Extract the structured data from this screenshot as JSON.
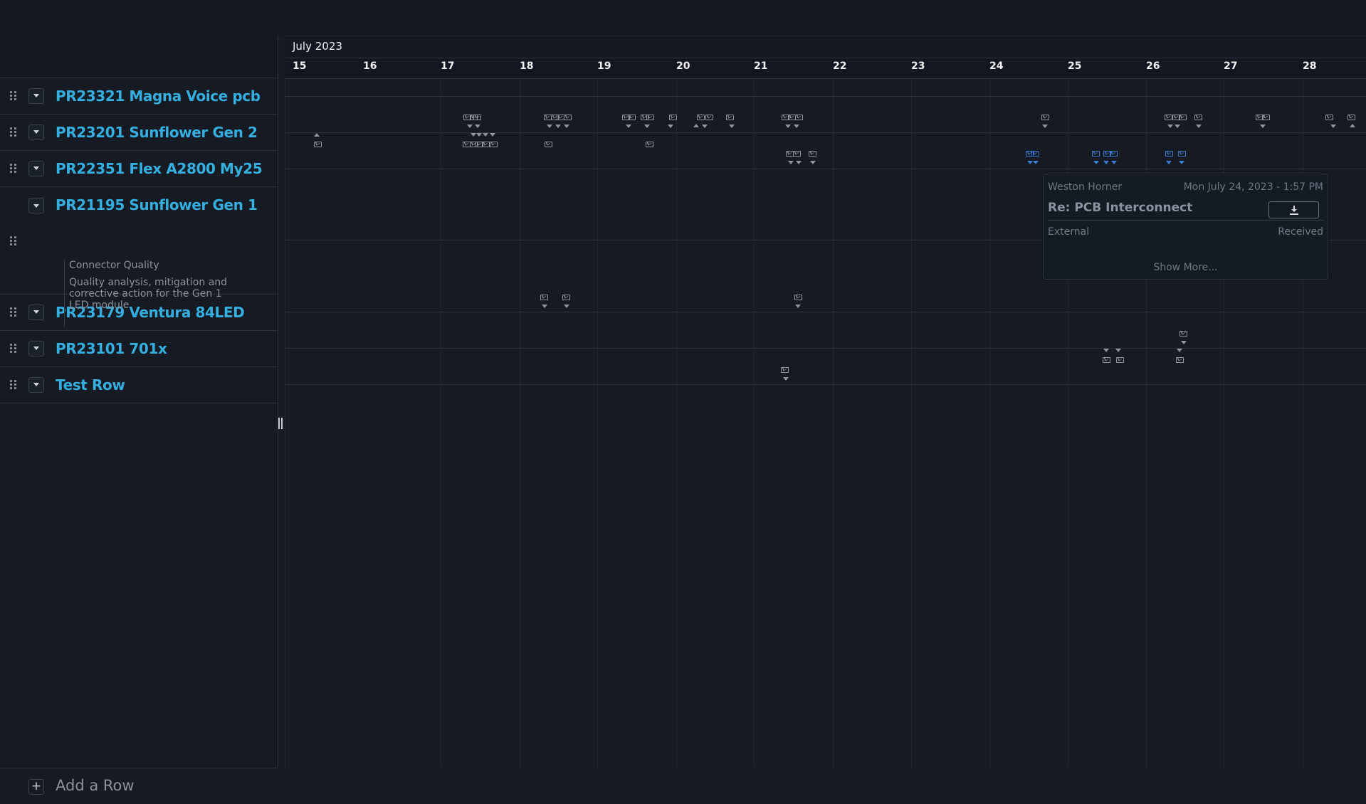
{
  "timeline": {
    "month": "July 2023",
    "days": [
      "15",
      "16",
      "17",
      "18",
      "19",
      "20",
      "21",
      "22",
      "23",
      "24",
      "25",
      "26",
      "27",
      "28"
    ]
  },
  "rows": [
    {
      "title": "PR23321 Magna Voice pcb"
    },
    {
      "title": "PR23201 Sunflower Gen 2"
    },
    {
      "title": "PR22351 Flex A2800 My25"
    },
    {
      "title": "PR21195 Sunflower Gen 1",
      "expanded": true,
      "detail_label": "Connector Quality",
      "detail_desc": "Quality analysis, mitigation and corrective action for the Gen 1 LED module"
    },
    {
      "title": "PR23179 Ventura 84LED"
    },
    {
      "title": "PR23101 701x"
    },
    {
      "title": "Test Row"
    }
  ],
  "add_row": {
    "label": "Add a Row"
  },
  "popover": {
    "sender": "Weston Horner",
    "date": "Mon July 24, 2023 - 1:57 PM",
    "subject": "Re: PCB Interconnect",
    "tag": "External",
    "status": "Received",
    "more": "Show More..."
  },
  "icons": {
    "drag": "drag-handle-icon",
    "toggle": "chevron-down-icon",
    "mail": "mail-icon",
    "add": "plus-icon",
    "download": "download-icon"
  },
  "colors": {
    "accent": "#35aee0",
    "selected_mail": "#3d7bd1",
    "background": "#151a23"
  }
}
